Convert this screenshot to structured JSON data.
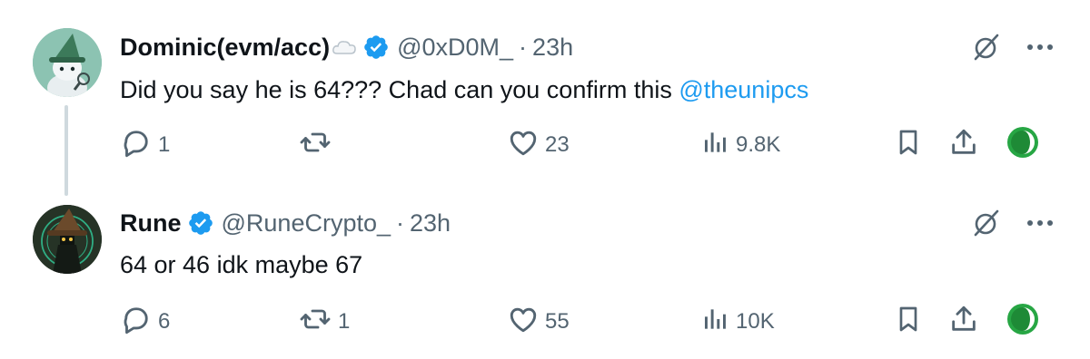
{
  "tweets": [
    {
      "name": "Dominic(evm/acc)",
      "handle": "@0xD0M_",
      "separator": "·",
      "time": "23h",
      "text": "Did you say he is 64??? Chad can you confirm this ",
      "mention": "@theunipcs",
      "stats": {
        "replies": "1",
        "retweets": "",
        "likes": "23",
        "views": "9.8K"
      },
      "icons": [
        "cloud-emoji-icon",
        "verified-badge-icon",
        "grok-icon",
        "more-icon",
        "reply-icon",
        "retweet-icon",
        "like-icon",
        "views-icon",
        "bookmark-icon",
        "share-icon",
        "extension-icon"
      ]
    },
    {
      "name": "Rune",
      "handle": "@RuneCrypto_",
      "separator": "·",
      "time": "23h",
      "text": "64 or 46 idk maybe 67",
      "mention": "",
      "stats": {
        "replies": "6",
        "retweets": "1",
        "likes": "55",
        "views": "10K"
      },
      "icons": [
        "verified-badge-icon",
        "grok-icon",
        "more-icon",
        "reply-icon",
        "retweet-icon",
        "like-icon",
        "views-icon",
        "bookmark-icon",
        "share-icon",
        "extension-icon"
      ]
    }
  ],
  "colors": {
    "text": "#0f1419",
    "secondary": "#536471",
    "mention": "#1d9bf0",
    "verified": "#1d9bf0",
    "thread_line": "#cfd9de",
    "extension": "#27a644"
  }
}
